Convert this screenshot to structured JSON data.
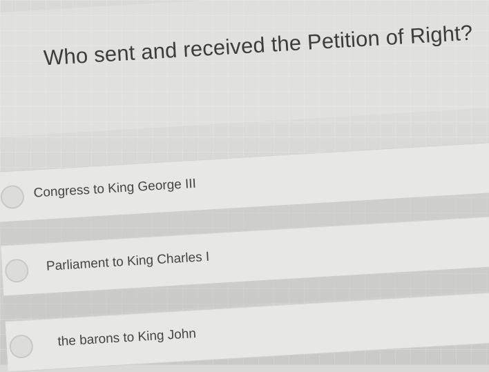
{
  "quiz": {
    "question": "Who sent and received the Petition of Right?",
    "options": [
      {
        "label": "Congress to King George III",
        "selected": false
      },
      {
        "label": "Parliament to King Charles I",
        "selected": false
      },
      {
        "label": "the barons to King John",
        "selected": false
      }
    ]
  }
}
